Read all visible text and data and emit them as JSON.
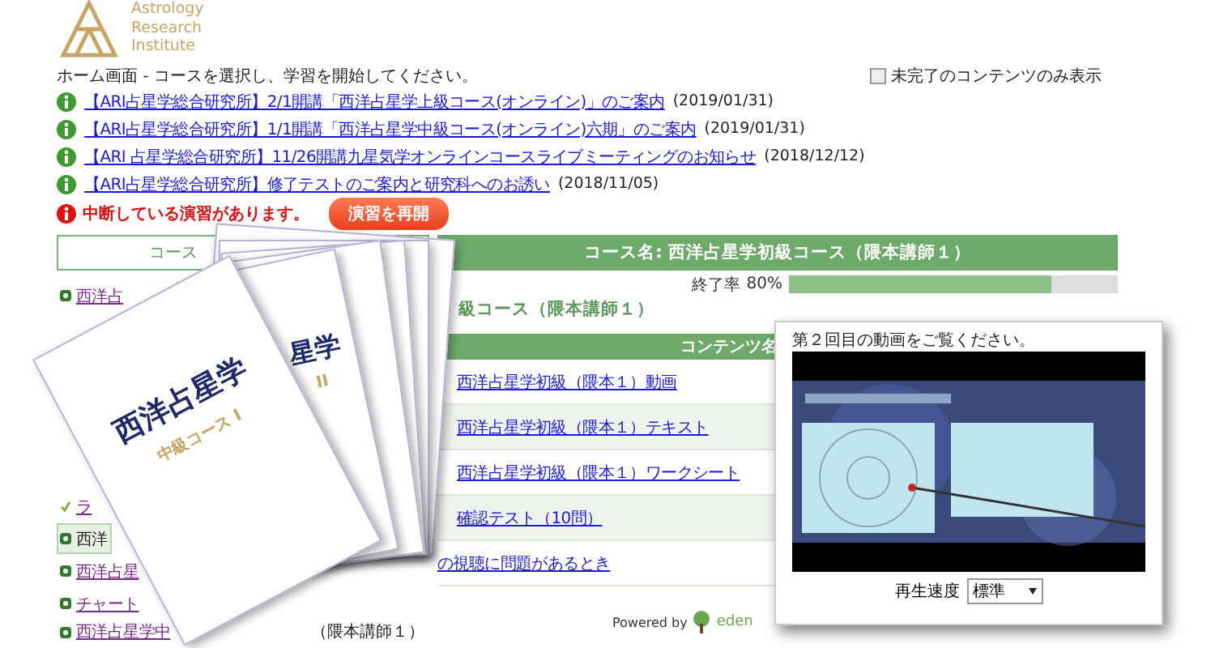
{
  "logo": {
    "lines": [
      "Astrology",
      "Research",
      "Institute"
    ]
  },
  "breadcrumb": "ホーム画面 - コースを選択し、学習を開始してください。",
  "filter": {
    "label": "未完了のコンテンツのみ表示",
    "checked": false
  },
  "news": [
    {
      "title": "【ARI占星学総合研究所】2/1開講「西洋占星学上級コース(オンライン)」のご案内",
      "date": "(2019/01/31)"
    },
    {
      "title": "【ARI占星学総合研究所】1/1開講「西洋占星学中級コース(オンライン)六期」のご案内",
      "date": "(2019/01/31)"
    },
    {
      "title": "【ARI 占星学総合研究所】11/26開講九星気学オンラインコースライブミーティングのお知らせ",
      "date": "(2018/12/12)"
    },
    {
      "title": "【ARI占星学総合研究所】修了テストのご案内と研究科へのお誘い",
      "date": "(2018/11/05)"
    }
  ],
  "alert": {
    "message": "中断している演習があります。",
    "button": "演習を再開"
  },
  "sidebar": {
    "header": "コース",
    "items": [
      {
        "label": "西洋占",
        "kind": "bullet",
        "selected": false
      },
      {
        "label": "ラ",
        "kind": "check",
        "selected": false
      },
      {
        "label": "西洋",
        "kind": "bullet",
        "selected": true
      },
      {
        "label": "西洋占星",
        "kind": "bullet",
        "selected": false
      },
      {
        "label": "チャート",
        "kind": "bullet",
        "selected": false
      },
      {
        "label": "西洋占星学中",
        "tail": "（隈本講師１）",
        "kind": "bullet",
        "selected": false
      }
    ]
  },
  "course": {
    "title": "コース名: 西洋占星学初級コース（隈本講師１）",
    "progress_label": "終了率",
    "progress_value": "80%",
    "level": 0.8,
    "subtitle": "級コース（隈本講師１）",
    "column": "コンテンツ名",
    "rows": [
      "西洋占星学初級（隈本１）動画",
      "西洋占星学初級（隈本１）テキスト",
      "西洋占星学初級（隈本１）ワークシート",
      "確認テスト（10問）"
    ],
    "help_link": "の視聴に問題があるとき"
  },
  "footer": {
    "powered": "Powered by",
    "brand": "eden"
  },
  "books": [
    {
      "title": "西洋占星学",
      "subtitle": "中級コース I"
    },
    {
      "title": "星学",
      "subtitle": "II"
    }
  ],
  "video": {
    "caption": "第２回目の動画をご覧ください。",
    "speed_label": "再生速度",
    "speed": "標準"
  }
}
